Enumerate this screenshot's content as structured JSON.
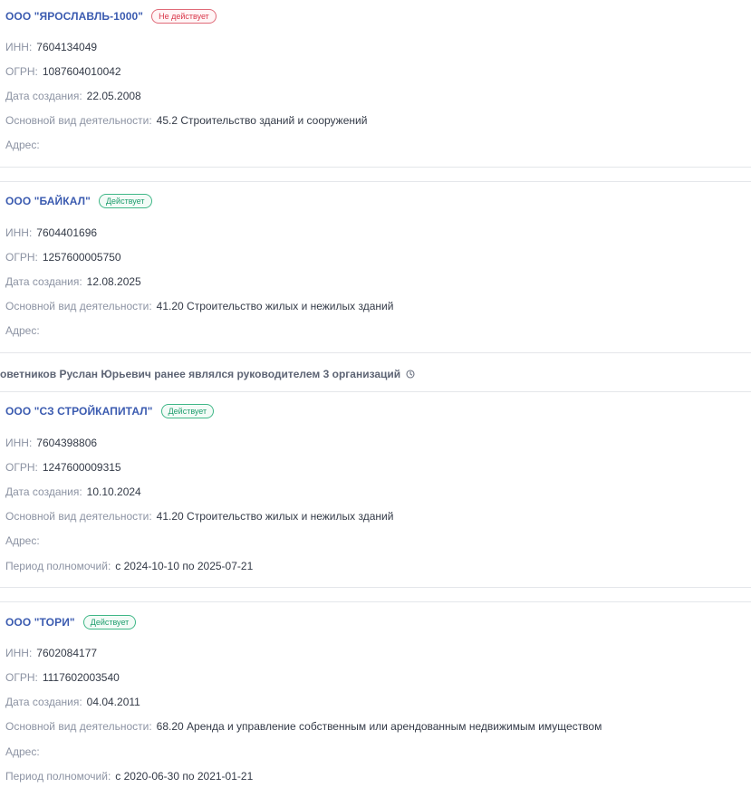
{
  "orgs_top": [
    {
      "name": "ООО \"ЯРОСЛАВЛЬ-1000\"",
      "status": "Не действует",
      "status_type": "inactive",
      "inn_label": "ИНН:",
      "inn": "7604134049",
      "ogrn_label": "ОГРН:",
      "ogrn": "1087604010042",
      "date_label": "Дата создания:",
      "date": "22.05.2008",
      "activity_label": "Основной вид деятельности:",
      "activity": "45.2 Строительство зданий и сооружений",
      "address_label": "Адрес:"
    },
    {
      "name": "ООО \"БАЙКАЛ\"",
      "status": "Действует",
      "status_type": "active",
      "inn_label": "ИНН:",
      "inn": "7604401696",
      "ogrn_label": "ОГРН:",
      "ogrn": "1257600005750",
      "date_label": "Дата создания:",
      "date": "12.08.2025",
      "activity_label": "Основной вид деятельности:",
      "activity": "41.20 Строительство жилых и нежилых зданий",
      "address_label": "Адрес:"
    }
  ],
  "former_section": {
    "heading": "оветников Руслан Юрьевич ранее являлся руководителем 3 организаций",
    "icon": "clock-icon"
  },
  "orgs_former": [
    {
      "name": "ООО \"СЗ СТРОЙКАПИТАЛ\"",
      "status": "Действует",
      "status_type": "active",
      "inn_label": "ИНН:",
      "inn": "7604398806",
      "ogrn_label": "ОГРН:",
      "ogrn": "1247600009315",
      "date_label": "Дата создания:",
      "date": "10.10.2024",
      "activity_label": "Основной вид деятельности:",
      "activity": "41.20 Строительство жилых и нежилых зданий",
      "address_label": "Адрес:",
      "period_label": "Период полномочий:",
      "period": "с 2024-10-10 по 2025-07-21"
    },
    {
      "name": "ООО \"ТОРИ\"",
      "status": "Действует",
      "status_type": "active",
      "inn_label": "ИНН:",
      "inn": "7602084177",
      "ogrn_label": "ОГРН:",
      "ogrn": "1117602003540",
      "date_label": "Дата создания:",
      "date": "04.04.2011",
      "activity_label": "Основной вид деятельности:",
      "activity": "68.20 Аренда и управление собственным или арендованным недвижимым имуществом",
      "address_label": "Адрес:",
      "period_label": "Период полномочий:",
      "period": "с 2020-06-30 по 2021-01-21"
    }
  ],
  "colors": {
    "link": "#3b5bb0",
    "inactive": "#d9384b",
    "active": "#1f9e6e",
    "label": "#8c93a3"
  }
}
